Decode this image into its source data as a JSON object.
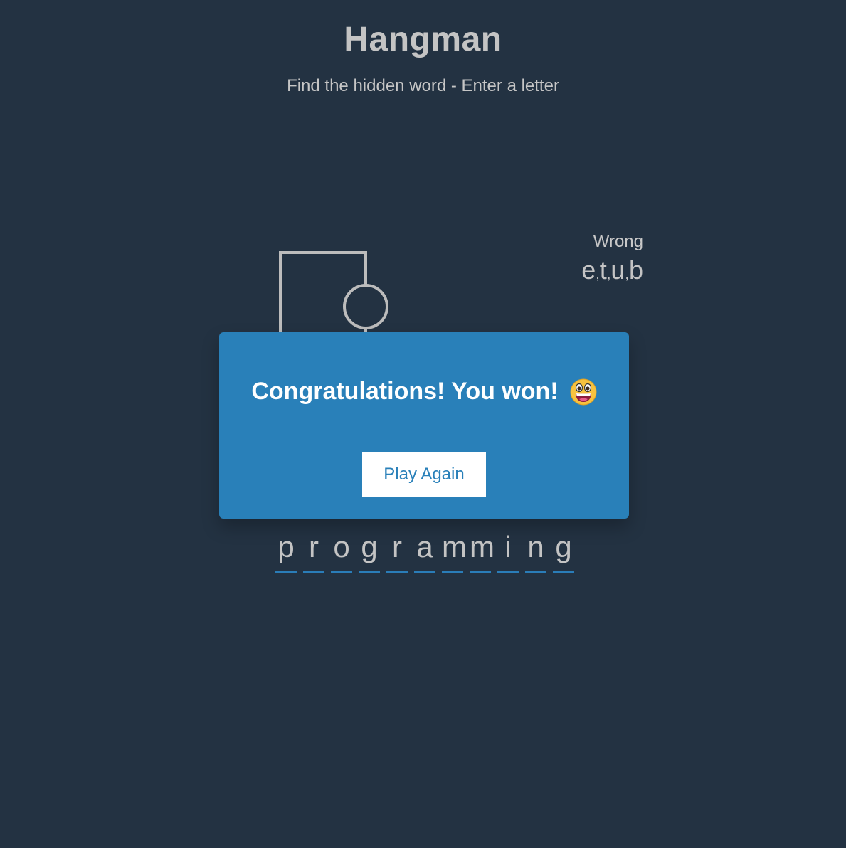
{
  "header": {
    "title": "Hangman",
    "subtitle": "Find the hidden word - Enter a letter"
  },
  "wrong": {
    "title": "Wrong",
    "letters": [
      "e",
      "t",
      "u",
      "b"
    ]
  },
  "word": {
    "letters": [
      "p",
      "r",
      "o",
      "g",
      "r",
      "a",
      "m",
      "m",
      "i",
      "n",
      "g"
    ]
  },
  "popup": {
    "message": "Congratulations! You won!",
    "emoji": "grinning-face-icon",
    "button_label": "Play Again"
  },
  "colors": {
    "background": "#233242",
    "accent": "#2980b9",
    "text": "#c4c4c4",
    "figure": "#bcbcbc"
  }
}
